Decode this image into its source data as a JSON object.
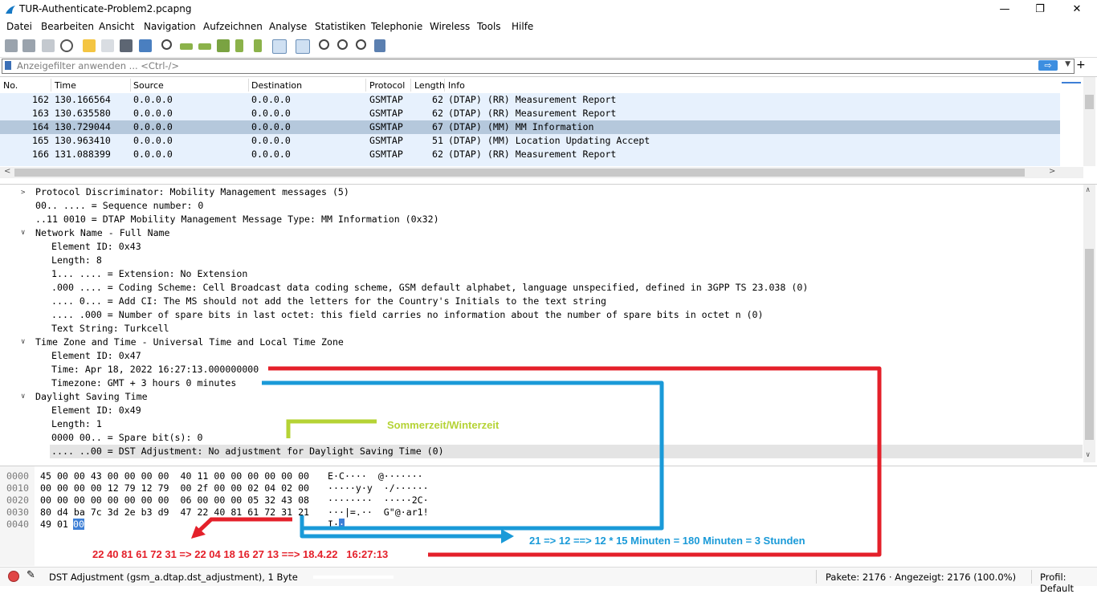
{
  "window": {
    "title": "TUR-Authenticate-Problem2.pcapng",
    "minimize": "—",
    "maximize": "❐",
    "close": "✕"
  },
  "menu": [
    "Datei",
    "Bearbeiten",
    "Ansicht",
    "Navigation",
    "Aufzeichnen",
    "Analyse",
    "Statistiken",
    "Telephonie",
    "Wireless",
    "Tools",
    "Hilfe"
  ],
  "filter": {
    "placeholder": "Anzeigefilter anwenden ... <Ctrl-/>",
    "apply": "⇨",
    "plus": "+"
  },
  "packet_list": {
    "columns": [
      "No.",
      "Time",
      "Source",
      "Destination",
      "Protocol",
      "Length",
      "Info"
    ],
    "rows": [
      {
        "no": "162",
        "time": "130.166564",
        "src": "0.0.0.0",
        "dst": "0.0.0.0",
        "proto": "GSMTAP",
        "len": "62",
        "info": "(DTAP) (RR) Measurement Report"
      },
      {
        "no": "163",
        "time": "130.635580",
        "src": "0.0.0.0",
        "dst": "0.0.0.0",
        "proto": "GSMTAP",
        "len": "62",
        "info": "(DTAP) (RR) Measurement Report"
      },
      {
        "no": "164",
        "time": "130.729044",
        "src": "0.0.0.0",
        "dst": "0.0.0.0",
        "proto": "GSMTAP",
        "len": "67",
        "info": "(DTAP) (MM) MM Information"
      },
      {
        "no": "165",
        "time": "130.963410",
        "src": "0.0.0.0",
        "dst": "0.0.0.0",
        "proto": "GSMTAP",
        "len": "51",
        "info": "(DTAP) (MM) Location Updating Accept"
      },
      {
        "no": "166",
        "time": "131.088399",
        "src": "0.0.0.0",
        "dst": "0.0.0.0",
        "proto": "GSMTAP",
        "len": "62",
        "info": "(DTAP) (RR) Measurement Report"
      }
    ]
  },
  "details": [
    "Protocol Discriminator: Mobility Management messages (5)",
    "00.. .... = Sequence number: 0",
    "..11 0010 = DTAP Mobility Management Message Type: MM Information (0x32)",
    "Network Name - Full Name",
    "Element ID: 0x43",
    "Length: 8",
    "1... .... = Extension: No Extension",
    ".000 .... = Coding Scheme: Cell Broadcast data coding scheme, GSM default alphabet, language unspecified, defined in 3GPP TS 23.038 (0)",
    ".... 0... = Add CI: The MS should not add the letters for the Country's Initials to the text string",
    ".... .000 = Number of spare bits in last octet: this field carries no information about the number of spare bits in octet n (0)",
    "Text String: Turkcell",
    "Time Zone and Time - Universal Time and Local Time Zone",
    "Element ID: 0x47",
    "Time: Apr 18, 2022 16:27:13.000000000",
    "Timezone: GMT + 3 hours 0 minutes",
    "Daylight Saving Time",
    "Element ID: 0x49",
    "Length: 1",
    "0000 00.. = Spare bit(s): 0",
    ".... ..00 = DST Adjustment: No adjustment for Daylight Saving Time (0)"
  ],
  "bytes": [
    {
      "off": "0000",
      "hex": "45 00 00 43 00 00 00 00  40 11 00 00 00 00 00 00",
      "ascii": "E·C····  @·······"
    },
    {
      "off": "0010",
      "hex": "00 00 00 00 12 79 12 79  00 2f 00 00 02 04 02 00",
      "ascii": "·····y·y  ·/······"
    },
    {
      "off": "0020",
      "hex": "00 00 00 00 00 00 00 00  06 00 00 00 05 32 43 08",
      "ascii": "········  ·····2C·"
    },
    {
      "off": "0030",
      "hex": "80 d4 ba 7c 3d 2e b3 d9  47 22 40 81 61 72 31 21",
      "ascii": "···|=.··  G\"@·ar1!"
    },
    {
      "off": "0040",
      "hex": "49 01",
      "hexsel": "00",
      "ascii": "I·",
      "asciisel": "·"
    }
  ],
  "annotations": {
    "dst": "Sommerzeit/Winterzeit",
    "tz": "21 => 12 ==> 12 * 15 Minuten = 180 Minuten = 3 Stunden",
    "time": "22 40 81 61 72 31 => 22 04 18 16 27 13 ==> 18.4.22   16:27:13",
    "colors": {
      "red": "#e4202a",
      "blue": "#1a9ad8",
      "green": "#b5d335"
    }
  },
  "status": {
    "field": "DST Adjustment (gsm_a.dtap.dst_adjustment), 1 Byte",
    "packets": "Pakete: 2176 · Angezeigt: 2176 (100.0%)",
    "profile": "Profil: Default"
  }
}
